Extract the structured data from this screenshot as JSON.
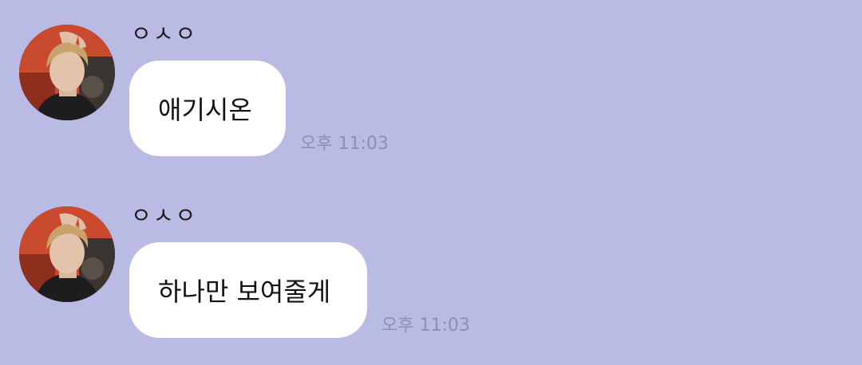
{
  "chat": {
    "background_color": "#babbe4",
    "bubble_color": "#ffffff",
    "messages": [
      {
        "sender": "ㅇㅅㅇ",
        "text": "애기시온",
        "time": "오후 11:03",
        "avatar": "profile-photo"
      },
      {
        "sender": "ㅇㅅㅇ",
        "text": "하나만 보여줄게",
        "time": "오후 11:03",
        "avatar": "profile-photo"
      }
    ]
  }
}
